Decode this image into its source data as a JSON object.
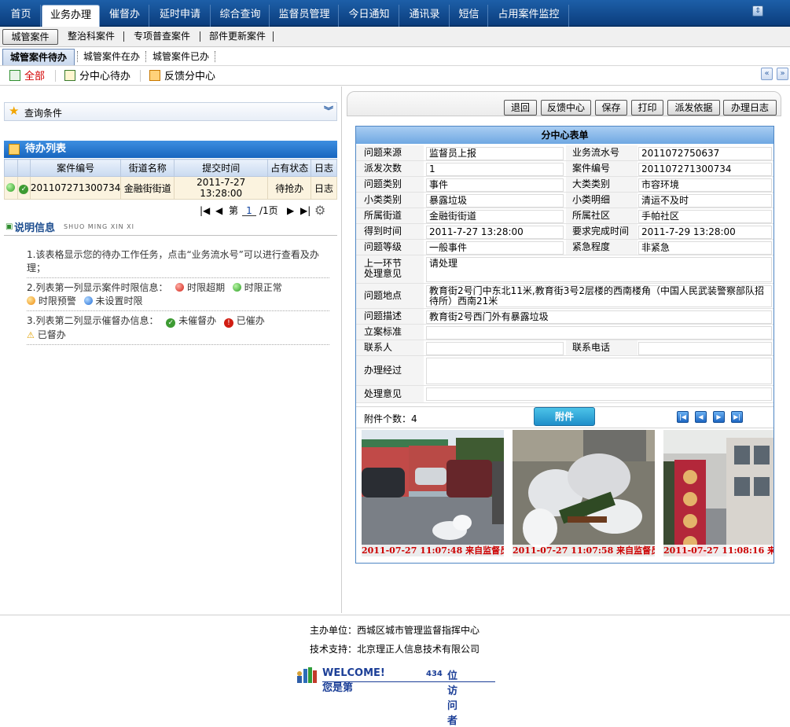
{
  "top_nav": {
    "tabs": [
      {
        "label": "首页"
      },
      {
        "label": "业务办理",
        "active": true
      },
      {
        "label": "催督办"
      },
      {
        "label": "延时申请"
      },
      {
        "label": "综合查询"
      },
      {
        "label": "监督员管理"
      },
      {
        "label": "今日通知"
      },
      {
        "label": "通讯录"
      },
      {
        "label": "短信"
      },
      {
        "label": "占用案件监控"
      }
    ]
  },
  "sub_nav": {
    "items": [
      "城管案件",
      "整治科案件",
      "专项普查案件",
      "部件更新案件"
    ]
  },
  "sub_tabs": {
    "items": [
      "城管案件待办",
      "城管案件在办",
      "城管案件已办"
    ]
  },
  "filter_bar": {
    "all": "全部",
    "center_pending": "分中心待办",
    "feedback_center": "反馈分中心"
  },
  "query": {
    "label": "查询条件"
  },
  "todo": {
    "title": "待办列表",
    "columns": [
      "案件编号",
      "街道名称",
      "提交时间",
      "占有状态",
      "日志"
    ],
    "rows": [
      {
        "case_no": "201107271300734",
        "street": "金融街街道",
        "time": "2011-7-27 13:28:00",
        "status": "待抢办",
        "log": "日志"
      }
    ],
    "pager": {
      "prefix": "第",
      "page": "1",
      "suffix": "/1页"
    }
  },
  "legend": {
    "title": "说明信息",
    "pinyin": "SHUO MING XIN XI",
    "item1": "1.该表格显示您的待办工作任务，点击“业务流水号”可以进行查看及办理；",
    "item2_prefix": "2.列表第一列显示案件时限信息：",
    "overdue": "时限超期",
    "normal": "时限正常",
    "warning": "时限预警",
    "no_limit": "未设置时限",
    "item3_prefix": "3.列表第二列显示催督办信息：",
    "not_urged": "未催督办",
    "urged": "已催办",
    "supervised": "已督办"
  },
  "actions": [
    "退回",
    "反馈中心",
    "保存",
    "打印",
    "派发依据",
    "办理日志"
  ],
  "form": {
    "title": "分中心表单",
    "source_label": "问题来源",
    "source": "监督员上报",
    "serial_label": "业务流水号",
    "serial": "2011072750637",
    "dispatch_label": "派发次数",
    "dispatch": "1",
    "case_label": "案件编号",
    "case": "201107271300734",
    "type_label": "问题类别",
    "type": "事件",
    "major_label": "大类类别",
    "major": "市容环境",
    "minor_label": "小类类别",
    "minor": "暴露垃圾",
    "detail_label": "小类明细",
    "detail": "清运不及时",
    "street_label": "所属街道",
    "street": "金融街街道",
    "community_label": "所属社区",
    "community": "手帕社区",
    "got_label": "得到时间",
    "got": "2011-7-27 13:28:00",
    "due_label": "要求完成时间",
    "due": "2011-7-29 13:28:00",
    "level_label": "问题等级",
    "level": "一般事件",
    "urgency_label": "紧急程度",
    "urgency": "非紧急",
    "prev_label_1": "上一环节",
    "prev_label_2": "处理意见",
    "prev": "请处理",
    "location_label": "问题地点",
    "location": "教育街2号门中东北11米,教育街3号2层楼的西南楼角（中国人民武装警察部队招待所）西南21米",
    "desc_label": "问题描述",
    "desc": "教育街2号西门外有暴露垃圾",
    "standard_label": "立案标准",
    "standard": "",
    "contact_label": "联系人",
    "contact": "",
    "phone_label": "联系电话",
    "phone": "",
    "process_label": "办理经过",
    "process": "",
    "opinion_label": "处理意见",
    "opinion": ""
  },
  "attachments": {
    "count_label": "附件个数：4",
    "tab_label": "附件",
    "photos": [
      {
        "caption": "2011-07-27 11:07:48 来自监督员"
      },
      {
        "caption": "2011-07-27 11:07:58 来自监督员"
      },
      {
        "caption": "2011-07-27 11:08:16 来"
      }
    ]
  },
  "footer": {
    "sponsor": "主办单位：西城区城市管理监督指挥中心",
    "support": "技术支持：北京理正人信息技术有限公司",
    "welcome": "WELCOME! 您是第",
    "count": "434",
    "suffix": "位访问者"
  },
  "colors": {
    "nav_blue": "#0b3d7d",
    "header_blue": "#1866bf",
    "accent_red": "#cc0000"
  }
}
